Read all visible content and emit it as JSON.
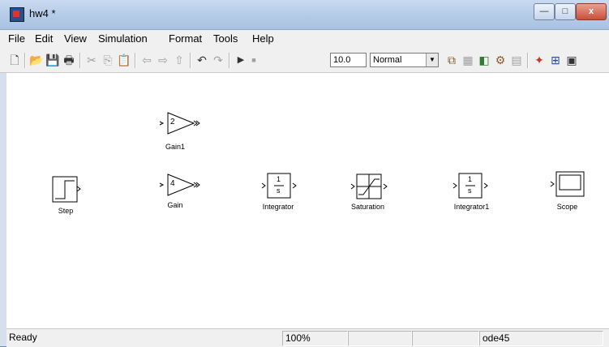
{
  "window": {
    "title": "hw4 *",
    "buttons": {
      "minimize": "—",
      "maximize": "□",
      "close": "x"
    }
  },
  "menu": [
    "File",
    "Edit",
    "View",
    "Simulation",
    "Format",
    "Tools",
    "Help"
  ],
  "toolbar": {
    "stop_time": "10.0",
    "sim_mode": "Normal"
  },
  "blocks": {
    "gain1": {
      "value": "2",
      "label": "Gain1"
    },
    "gain": {
      "value": "4",
      "label": "Gain"
    },
    "step": {
      "label": "Step"
    },
    "integrator": {
      "num": "1",
      "den": "s",
      "label": "Integrator"
    },
    "saturation": {
      "label": "Saturation"
    },
    "integrator1": {
      "num": "1",
      "den": "s",
      "label": "Integrator1"
    },
    "scope": {
      "label": "Scope"
    }
  },
  "status": {
    "state": "Ready",
    "zoom": "100%",
    "solver": "ode45"
  }
}
